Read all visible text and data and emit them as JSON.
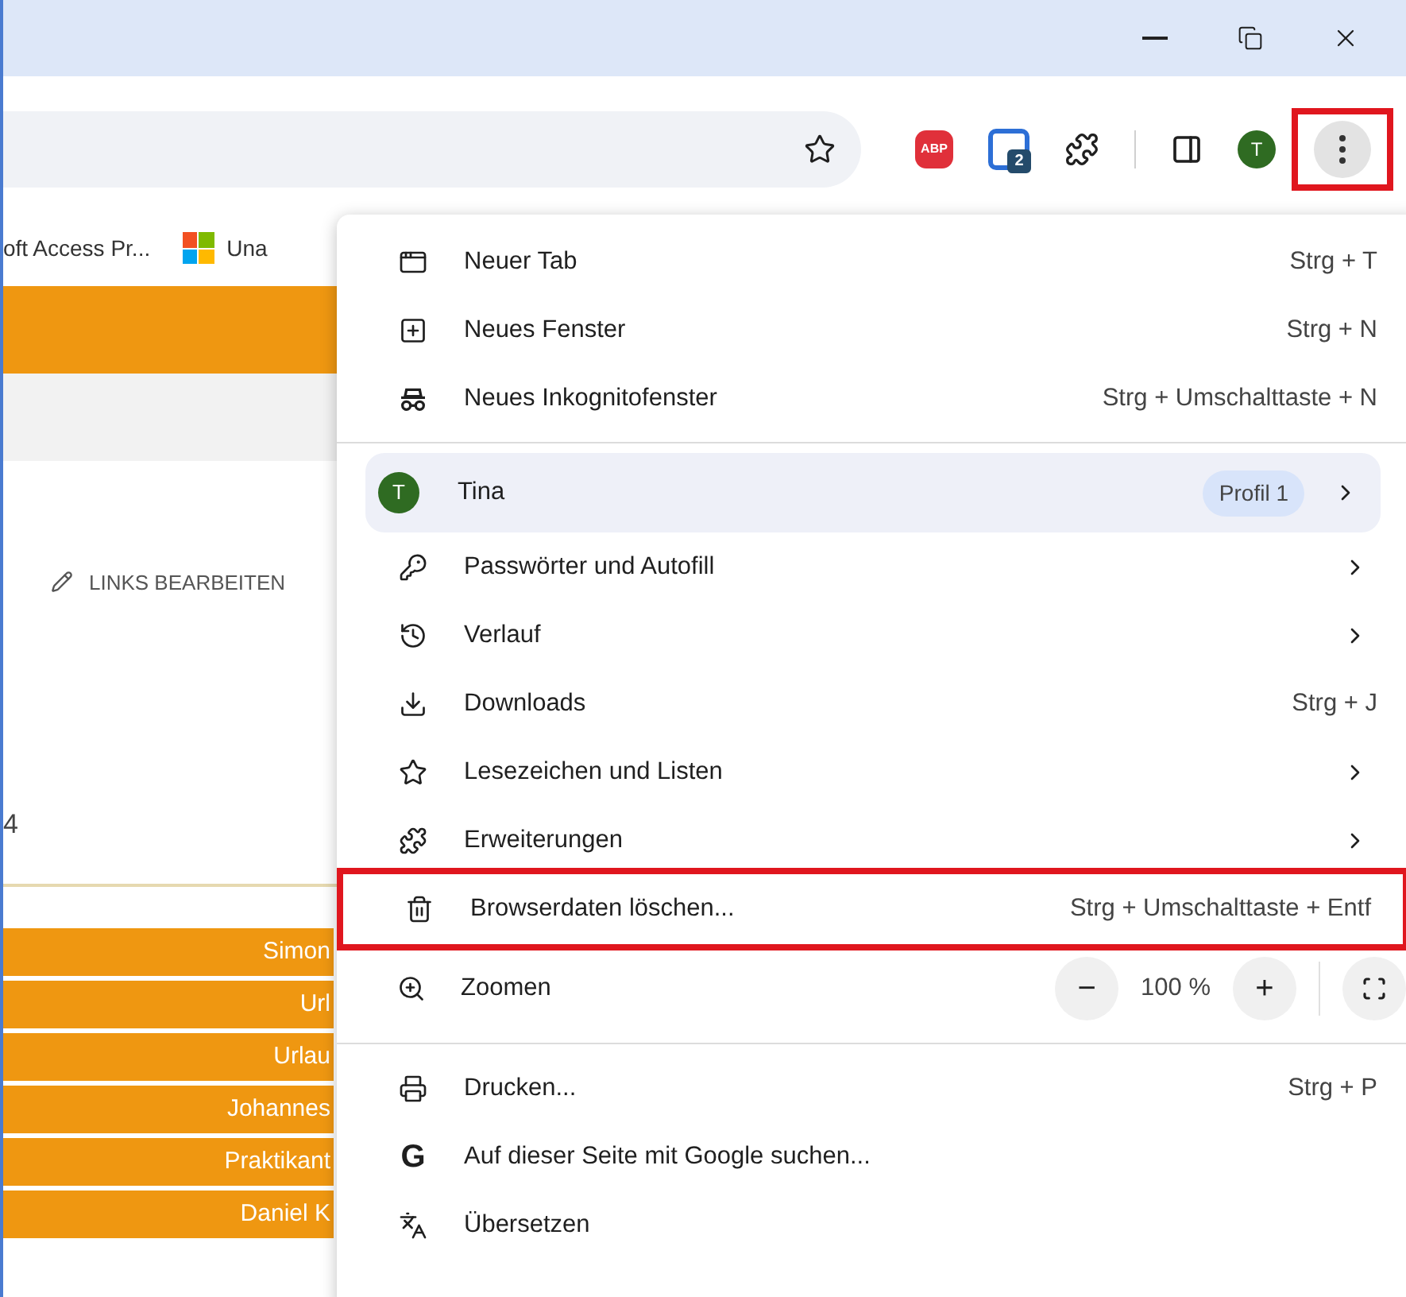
{
  "toolbar": {
    "extension_badges": [
      "ABP",
      "2"
    ],
    "avatar": "T",
    "menu_button_highlighted": true
  },
  "bookmarks": [
    "oft Access Pr...",
    "Una"
  ],
  "page": {
    "edit_link": "LINKS BEARBEITEN",
    "number": "4",
    "rows": [
      "Simon",
      "Url",
      "Urlau",
      "Johannes",
      "Praktikant",
      "Daniel K"
    ]
  },
  "menu": [
    {
      "kind": "item",
      "label": "Neuer Tab",
      "shortcut": "Strg + T",
      "submenu": false,
      "highlighted": false
    },
    {
      "kind": "item",
      "label": "Neues Fenster",
      "shortcut": "Strg + N",
      "submenu": false,
      "highlighted": false
    },
    {
      "kind": "item",
      "label": "Neues Inkognitofenster",
      "shortcut": "Strg + Umschalttaste + N",
      "submenu": false,
      "highlighted": false
    },
    {
      "kind": "divider"
    },
    {
      "kind": "profile",
      "avatar": "T",
      "label": "Tina",
      "badge": "Profil 1",
      "submenu": true
    },
    {
      "kind": "item",
      "label": "Passwörter und Autofill",
      "submenu": true,
      "highlighted": false
    },
    {
      "kind": "item",
      "label": "Verlauf",
      "submenu": true,
      "highlighted": false
    },
    {
      "kind": "item",
      "label": "Downloads",
      "shortcut": "Strg + J",
      "submenu": false,
      "highlighted": false
    },
    {
      "kind": "item",
      "label": "Lesezeichen und Listen",
      "submenu": true,
      "highlighted": false
    },
    {
      "kind": "item",
      "label": "Erweiterungen",
      "submenu": true,
      "highlighted": false
    },
    {
      "kind": "item",
      "label": "Browserdaten löschen...",
      "shortcut": "Strg + Umschalttaste + Entf",
      "submenu": false,
      "highlighted": true
    },
    {
      "kind": "zoom",
      "label": "Zoomen",
      "value": "100 %",
      "minus": "−",
      "plus": "+"
    },
    {
      "kind": "divider"
    },
    {
      "kind": "item",
      "label": "Drucken...",
      "shortcut": "Strg + P",
      "submenu": false,
      "highlighted": false
    },
    {
      "kind": "item",
      "label": "Auf dieser Seite mit Google suchen...",
      "glyph": "G",
      "submenu": false,
      "highlighted": false
    },
    {
      "kind": "item",
      "label": "Übersetzen",
      "submenu": false,
      "highlighted": false
    }
  ]
}
